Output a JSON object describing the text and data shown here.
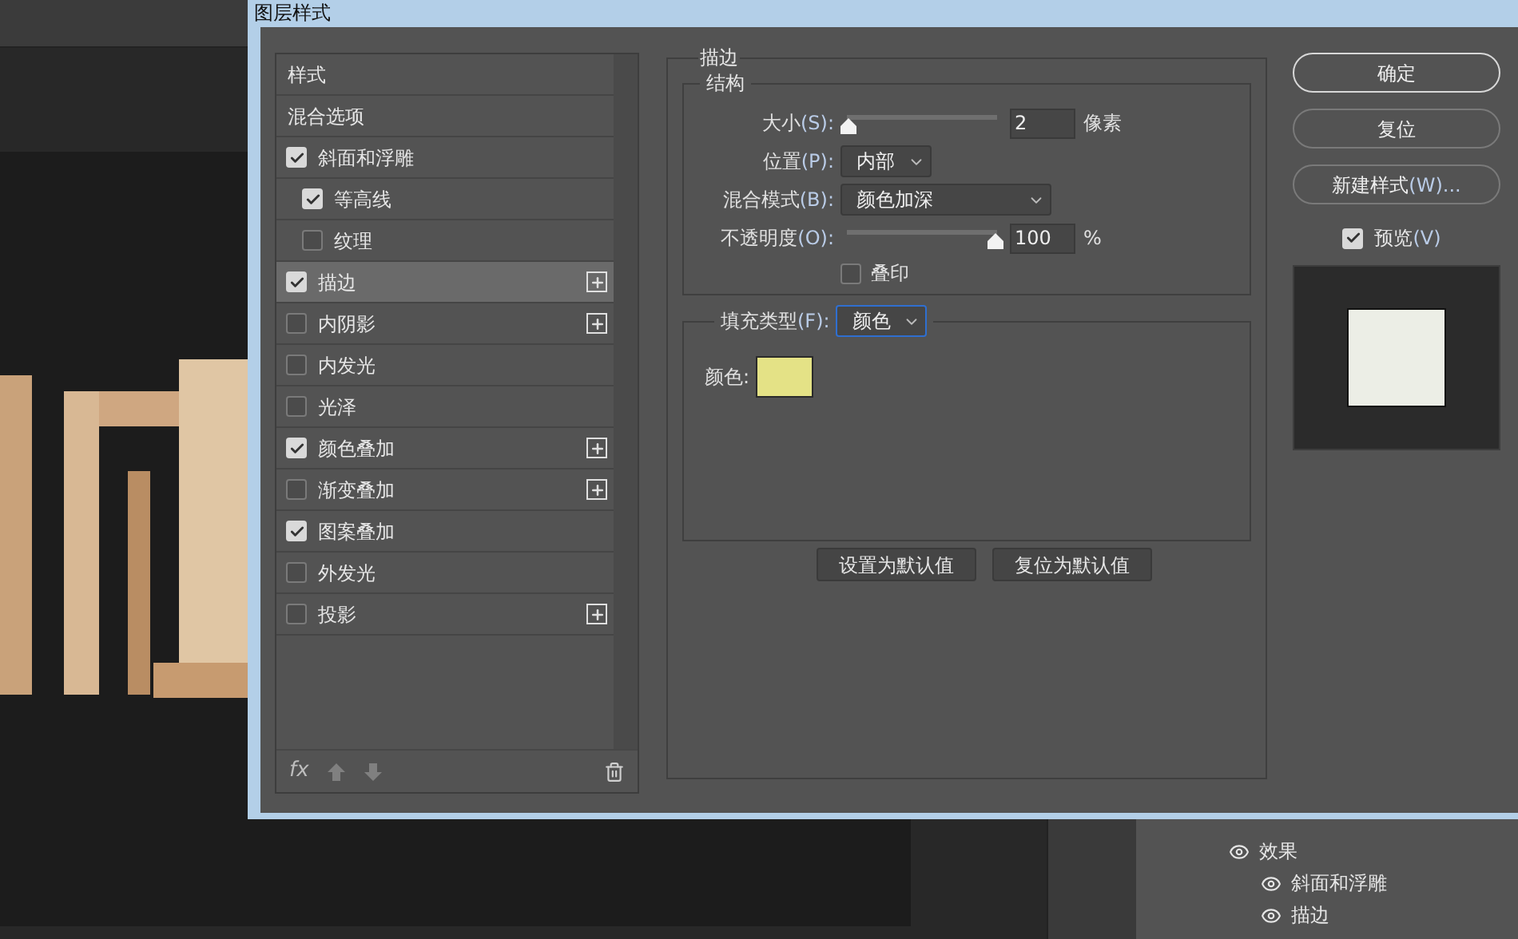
{
  "app": {
    "layers_panel": {
      "items": [
        {
          "label": "效果",
          "visible": true,
          "children": [
            {
              "label": "斜面和浮雕",
              "visible": true
            },
            {
              "label": "描边",
              "visible": true
            }
          ]
        }
      ]
    }
  },
  "dialog": {
    "title": "图层样式",
    "styles": [
      {
        "label": "样式",
        "kind": "header",
        "selected": false
      },
      {
        "label": "混合选项",
        "kind": "header",
        "selected": false
      },
      {
        "label": "斜面和浮雕",
        "kind": "effect",
        "checked": true,
        "selected": false,
        "plus": false,
        "children": [
          {
            "label": "等高线",
            "kind": "effect",
            "checked": true,
            "selected": false,
            "plus": false
          },
          {
            "label": "纹理",
            "kind": "effect",
            "checked": false,
            "selected": false,
            "plus": false
          }
        ]
      },
      {
        "label": "描边",
        "kind": "effect",
        "checked": true,
        "selected": true,
        "plus": true
      },
      {
        "label": "内阴影",
        "kind": "effect",
        "checked": false,
        "selected": false,
        "plus": true
      },
      {
        "label": "内发光",
        "kind": "effect",
        "checked": false,
        "selected": false,
        "plus": false
      },
      {
        "label": "光泽",
        "kind": "effect",
        "checked": false,
        "selected": false,
        "plus": false
      },
      {
        "label": "颜色叠加",
        "kind": "effect",
        "checked": true,
        "selected": false,
        "plus": true
      },
      {
        "label": "渐变叠加",
        "kind": "effect",
        "checked": false,
        "selected": false,
        "plus": true
      },
      {
        "label": "图案叠加",
        "kind": "effect",
        "checked": true,
        "selected": false,
        "plus": false
      },
      {
        "label": "外发光",
        "kind": "effect",
        "checked": false,
        "selected": false,
        "plus": false
      },
      {
        "label": "投影",
        "kind": "effect",
        "checked": false,
        "selected": false,
        "plus": true
      }
    ],
    "fx_label": "fx",
    "stroke": {
      "title": "描边",
      "structure": {
        "title": "结构",
        "size": {
          "label": "大小",
          "accel": "(S):",
          "level": 0,
          "value": "2",
          "unit": "像素"
        },
        "position": {
          "label": "位置",
          "accel": "(P):",
          "value": "内部"
        },
        "blend_mode": {
          "label": "混合模式",
          "accel": "(B):",
          "value": "颜色加深"
        },
        "opacity": {
          "label": "不透明度",
          "accel": "(O):",
          "level": 1,
          "value": "100",
          "unit": "%"
        },
        "overprint": {
          "label": "叠印",
          "checked": false
        }
      },
      "fill": {
        "label": "填充类型",
        "accel": "(F):",
        "value": "颜色",
        "focused": true,
        "color_label": "颜色:",
        "color": "#e4e286"
      },
      "default_buttons": [
        "设置为默认值",
        "复位为默认值"
      ]
    },
    "buttons": [
      {
        "label": "确定",
        "default": true
      },
      {
        "label": "复位",
        "default": false
      },
      {
        "label": "新建样式",
        "accel": "(W)...",
        "default": false
      }
    ],
    "preview": {
      "label": "预览",
      "accel": "(V)",
      "checked": true
    }
  }
}
